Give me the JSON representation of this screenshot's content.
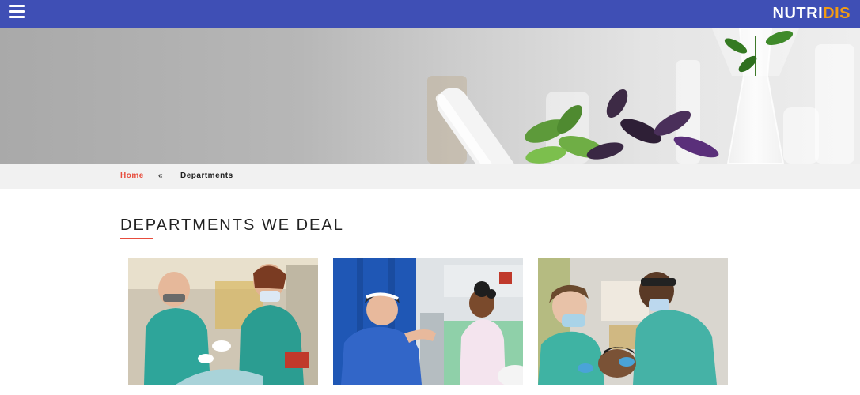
{
  "header": {
    "logo_part1": "NUTRI",
    "logo_part2": "DIS",
    "menu_icon": "hamburger-menu-icon",
    "bg_color": "#3f4fb5",
    "logo_accent": "#f39c12"
  },
  "hero": {
    "image": "laboratory-glassware-plant-banner"
  },
  "breadcrumb": {
    "home": "Home",
    "separator": "«",
    "current": "Departments"
  },
  "section": {
    "title": "DEPARTMENTS WE DEAL",
    "accent": "#e74c3c"
  },
  "departments": [
    {
      "image": "dentists-treating-patient-photo"
    },
    {
      "image": "doctor-talking-with-child-patient-photo"
    },
    {
      "image": "dentist-examining-patient-photo"
    }
  ]
}
